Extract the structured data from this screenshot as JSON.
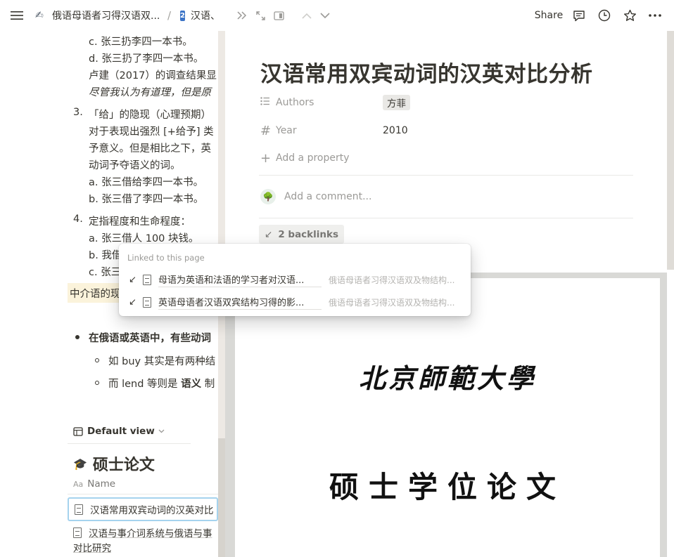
{
  "topbar": {
    "breadcrumb_parent": "俄语母语者习得汉语双...",
    "separator": "/",
    "breadcrumb_current_badge": "2",
    "breadcrumb_current": "汉语、"
  },
  "peekbar": {
    "share_label": "Share"
  },
  "left": {
    "lines": [
      "c. 张三扔李四一本书。",
      "d. 张三扔了李四一本书。",
      "卢建（2017）的调查结果显",
      "尽管我认为有道理，但是原"
    ],
    "item3_num": "3.",
    "item3_lines": [
      "「给」的隐现（心理预期）",
      "对于表现出强烈 [+给予] 类",
      "予意义。但是相比之下，英",
      "动词予夺语义的词。",
      "a. 张三借给李四一本书。",
      "b. 张三借了李四一本书。"
    ],
    "item4_num": "4.",
    "item4_lines": [
      "定指程度和生命程度：",
      "a. 张三借人 100 块钱。",
      "b. 我借",
      "c. 张三"
    ],
    "highlight": "中介语的现",
    "bullet_text": "在俄语或英语中，有些动词",
    "sub1_a": "如 buy 其实是有两种结",
    "sub2_a": "而 lend 等则是",
    "sub2_b": "语义",
    "sub2_c": "制",
    "default_view": "Default view",
    "db_icon": "🎓",
    "db_title": "硕士论文",
    "col_name_icon": "Aa",
    "col_name": "Name",
    "row1": "汉语常用双宾动词的汉英对比",
    "row2_line1": "汉语与事介词系统与俄语与事",
    "row2_line2": "对比研究"
  },
  "peek": {
    "title": "汉语常用双宾动词的汉英对比分析",
    "prop_authors_label": "Authors",
    "prop_authors_value": "方菲",
    "prop_year_label": "Year",
    "prop_year_value": "2010",
    "add_property": "Add a property",
    "add_comment": "Add a comment...",
    "backlinks": "2 backlinks",
    "pdf_university": "北京師範大學",
    "pdf_thesis": "硕士学位论文"
  },
  "popup": {
    "label": "Linked to this page",
    "links": [
      {
        "title": "母语为英语和法语的学习者对汉语...",
        "source": "俄语母语者习得汉语双及物结构..."
      },
      {
        "title": "英语母语者汉语双宾结构习得的影...",
        "source": "俄语母语者习得汉语双及物结构..."
      }
    ]
  },
  "colors": {
    "highlight_bg": "#fbf3db",
    "badge": "#3b73c6",
    "selected_row_border": "#a5d3ee"
  }
}
